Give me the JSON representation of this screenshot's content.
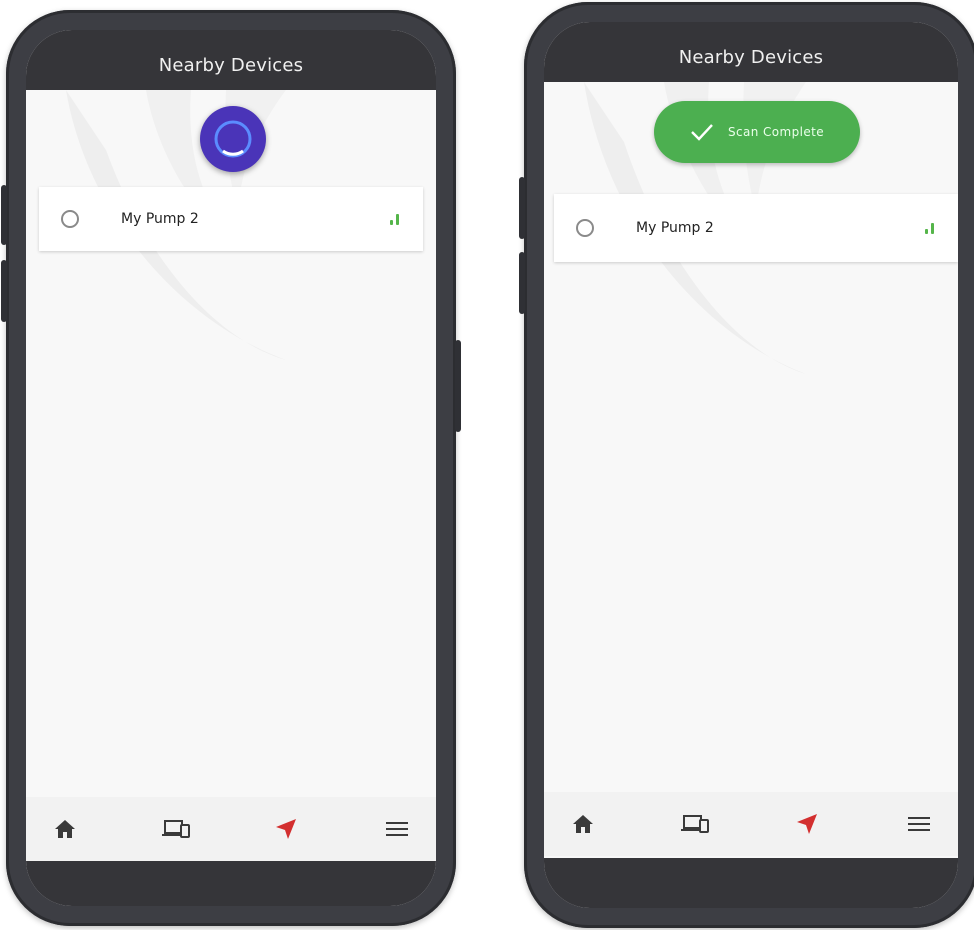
{
  "screens": [
    {
      "title": "Nearby Devices",
      "state": "scanning",
      "devices": [
        {
          "name": "My Pump 2",
          "selected": false,
          "signal": "low"
        }
      ],
      "nav": [
        {
          "icon": "home-icon"
        },
        {
          "icon": "devices-icon"
        },
        {
          "icon": "navigation-arrow-icon",
          "active": true
        },
        {
          "icon": "menu-icon"
        }
      ]
    },
    {
      "title": "Nearby Devices",
      "state": "complete",
      "banner": "Scan Complete",
      "devices": [
        {
          "name": "My Pump 2",
          "selected": false,
          "signal": "low"
        }
      ],
      "nav": [
        {
          "icon": "home-icon"
        },
        {
          "icon": "devices-icon"
        },
        {
          "icon": "navigation-arrow-icon",
          "active": true
        },
        {
          "icon": "menu-icon"
        }
      ]
    }
  ],
  "colors": {
    "header": "#353539",
    "accent_purple": "#4a34b8",
    "success_green": "#4caf50",
    "signal_green": "#55b54a",
    "nav_active_red": "#d32f2f",
    "nav_icon": "#3a3a3a"
  }
}
